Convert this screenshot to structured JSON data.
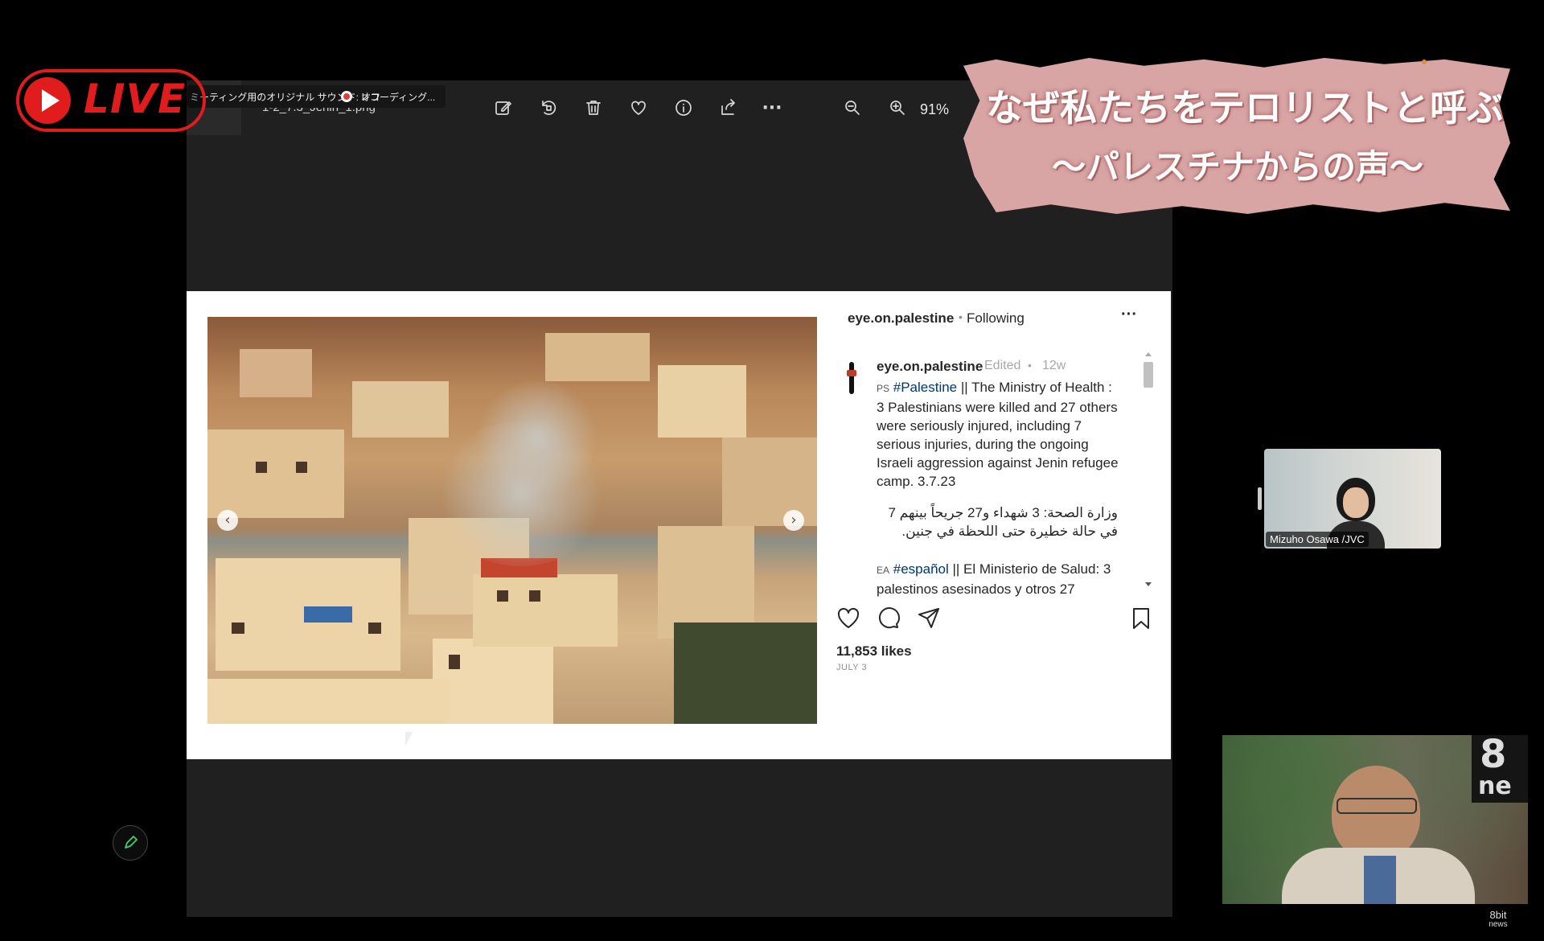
{
  "live_badge": {
    "label": "LIVE"
  },
  "recording_bar": {
    "original_sound": "ミーティング用のオリジナル サウンド: オフ",
    "recording": "レコーディング..."
  },
  "viewer": {
    "filename": "1-2_7.3_Jenin_1.png",
    "zoom": "91%",
    "toolbar_icons": [
      "edit-icon",
      "rotate-icon",
      "delete-icon",
      "favorite-icon",
      "info-icon",
      "share-icon",
      "more-icon",
      "zoom-out-icon",
      "zoom-in-icon"
    ],
    "more_label": "···"
  },
  "instagram": {
    "header_user": "eye.on.palestine",
    "header_dot": "•",
    "header_follow": "Following",
    "header_more": "···",
    "caption_user": "eye.on.palestine",
    "caption_edited": "Edited",
    "caption_dot": "•",
    "caption_age": "12w",
    "ps_label": "PS",
    "hashtag_palestine": "#Palestine",
    "caption_en_1": " || The Ministry of Health :",
    "caption_en_lines": [
      "3 Palestinians were killed and 27 others",
      "were seriously injured, including 7",
      "serious injuries, during the ongoing",
      "Israeli aggression against Jenin refugee",
      "camp. 3.7.23"
    ],
    "caption_ar_lines": [
      "وزارة الصحة: 3 شهداء و27 جريحاً بينهم 7",
      "في حالة خطيرة حتى اللحظة في جنين."
    ],
    "ea_label": "EA",
    "hashtag_espanol": "#español",
    "caption_es_1": " || El Ministerio de Salud: 3",
    "caption_es_2": "palestinos asesinados y otros 27",
    "likes": "11,853 likes",
    "date": "JULY 3",
    "carousel_prev": "‹",
    "carousel_next": "›"
  },
  "banner": {
    "line1": "なぜ私たちをテロリストと呼ぶ？",
    "line2": "〜パレスチナからの声〜"
  },
  "participants": [
    {
      "name": "Mizuho Osawa /JVC"
    }
  ],
  "watermark": {
    "line1": "8bit",
    "line2": "news"
  },
  "side_logo": {
    "line1": "8",
    "line2": "ne"
  },
  "colors": {
    "live_red": "#e01c1c",
    "banner_pink": "#d8a4a4",
    "ig_link": "#00376b",
    "pen_green": "#3fd06a"
  }
}
